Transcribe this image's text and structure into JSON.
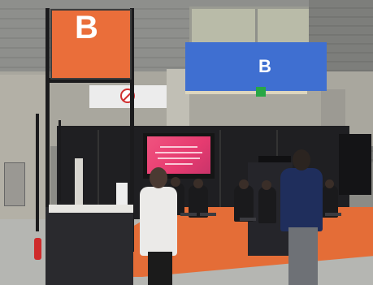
{
  "photo": {
    "description_tag": "exhibition-hall-booth-photo",
    "signs": {
      "orange_sign_letter": "B",
      "blue_sign_letter": "B"
    },
    "colors": {
      "orange_sign": "#ea6e3a",
      "blue_sign": "#3f6fd1",
      "carpet": "#e46d37",
      "screen": "#e63b70"
    }
  }
}
